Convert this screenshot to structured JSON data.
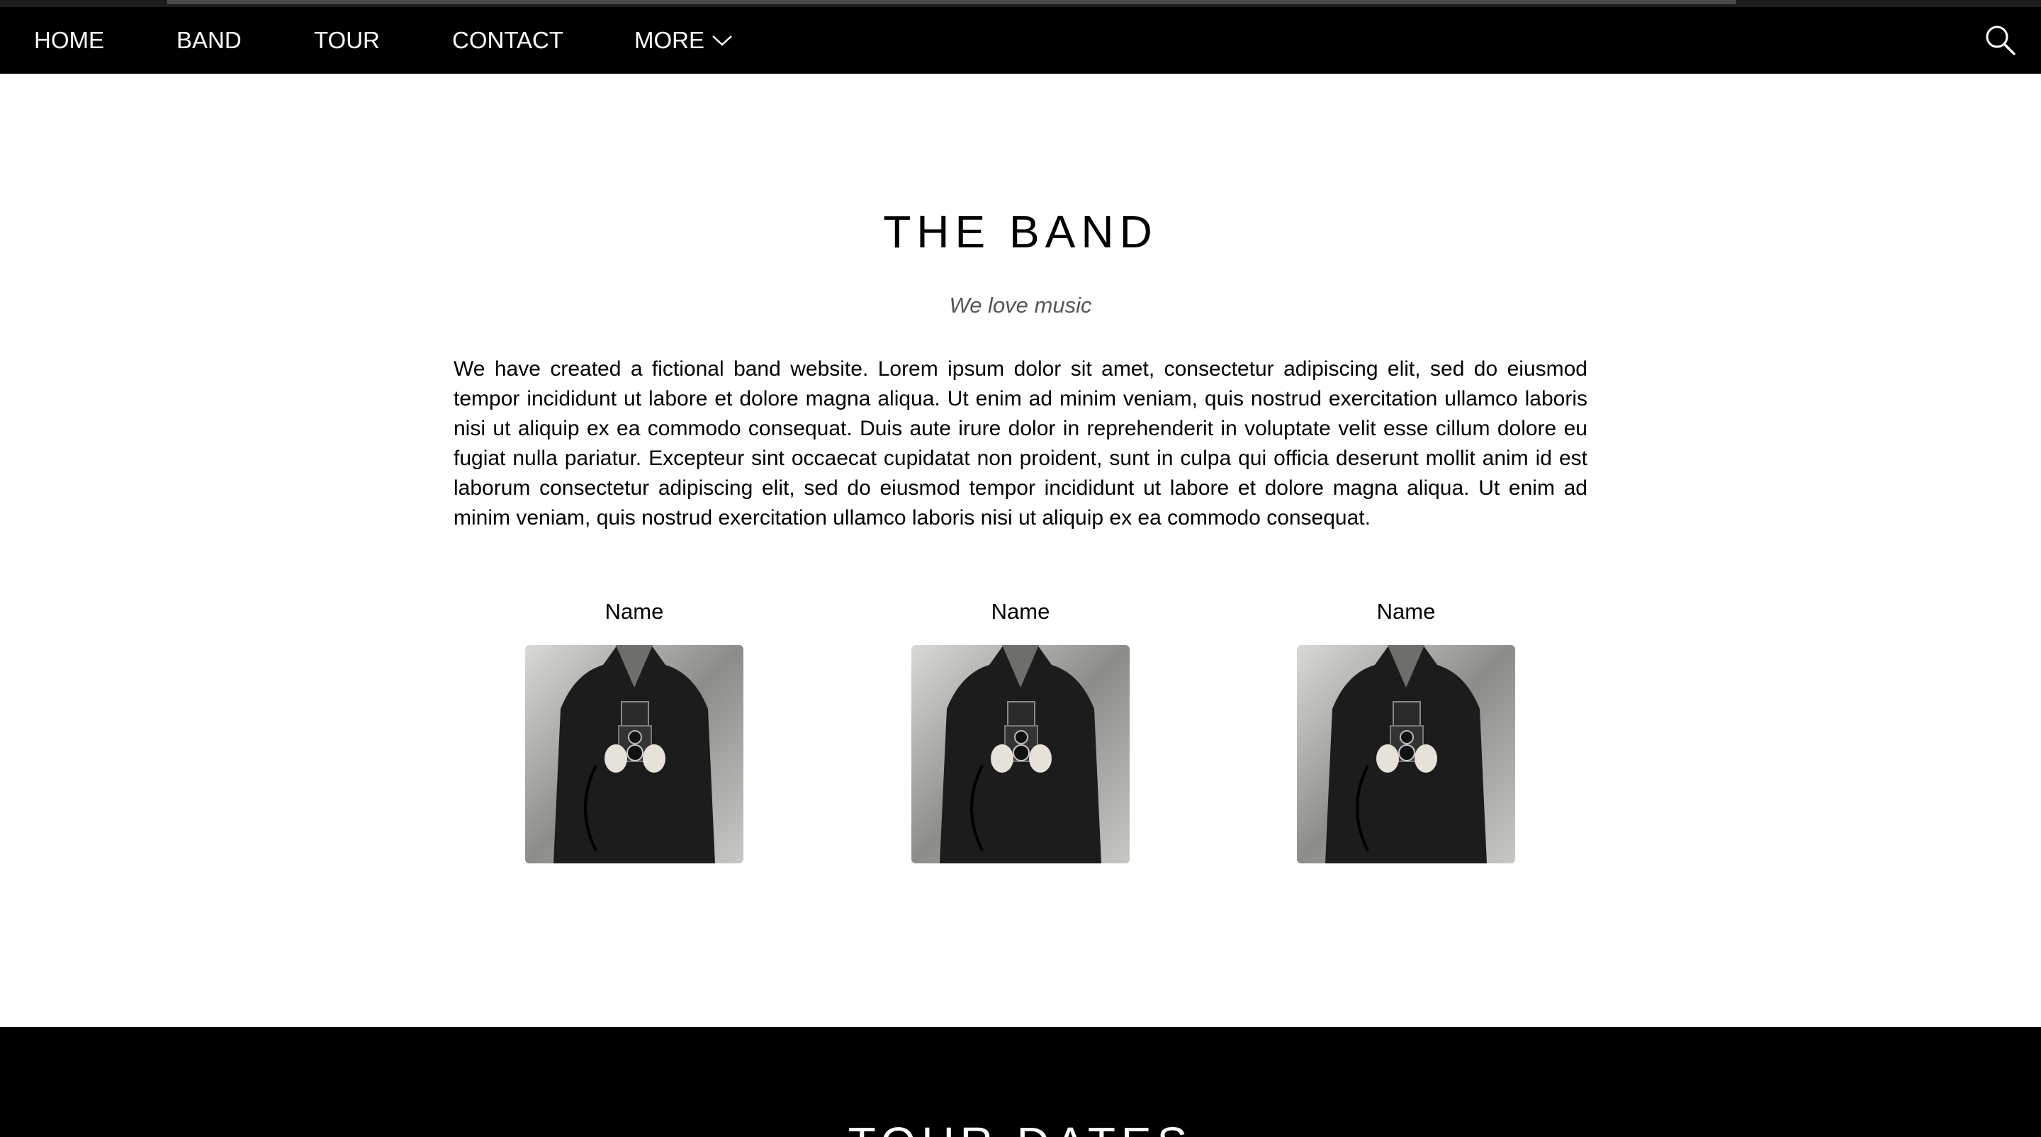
{
  "nav": {
    "items": [
      {
        "label": "HOME"
      },
      {
        "label": "BAND"
      },
      {
        "label": "TOUR"
      },
      {
        "label": "CONTACT"
      },
      {
        "label": "MORE"
      }
    ],
    "more_icon": "chevron-down-icon",
    "search_icon": "search-icon"
  },
  "band": {
    "title": "THE BAND",
    "subtitle": "We love music",
    "description": "We have created a fictional band website. Lorem ipsum dolor sit amet, consectetur adipiscing elit, sed do eiusmod tempor incididunt ut labore et dolore magna aliqua. Ut enim ad minim veniam, quis nostrud exercitation ullamco laboris nisi ut aliquip ex ea commodo consequat. Duis aute irure dolor in reprehenderit in voluptate velit esse cillum dolore eu fugiat nulla pariatur. Excepteur sint occaecat cupidatat non proident, sunt in culpa qui officia deserunt mollit anim id est laborum consectetur adipiscing elit, sed do eiusmod tempor incididunt ut labore et dolore magna aliqua. Ut enim ad minim veniam, quis nostrud exercitation ullamco laboris nisi ut aliquip ex ea commodo consequat.",
    "members": [
      {
        "name": "Name"
      },
      {
        "name": "Name"
      },
      {
        "name": "Name"
      }
    ]
  },
  "tour": {
    "title": "TOUR DATES"
  },
  "colors": {
    "navbar_bg": "#000000",
    "nav_text": "#ffffff",
    "subtitle": "#555555",
    "tour_bg": "#000000"
  }
}
